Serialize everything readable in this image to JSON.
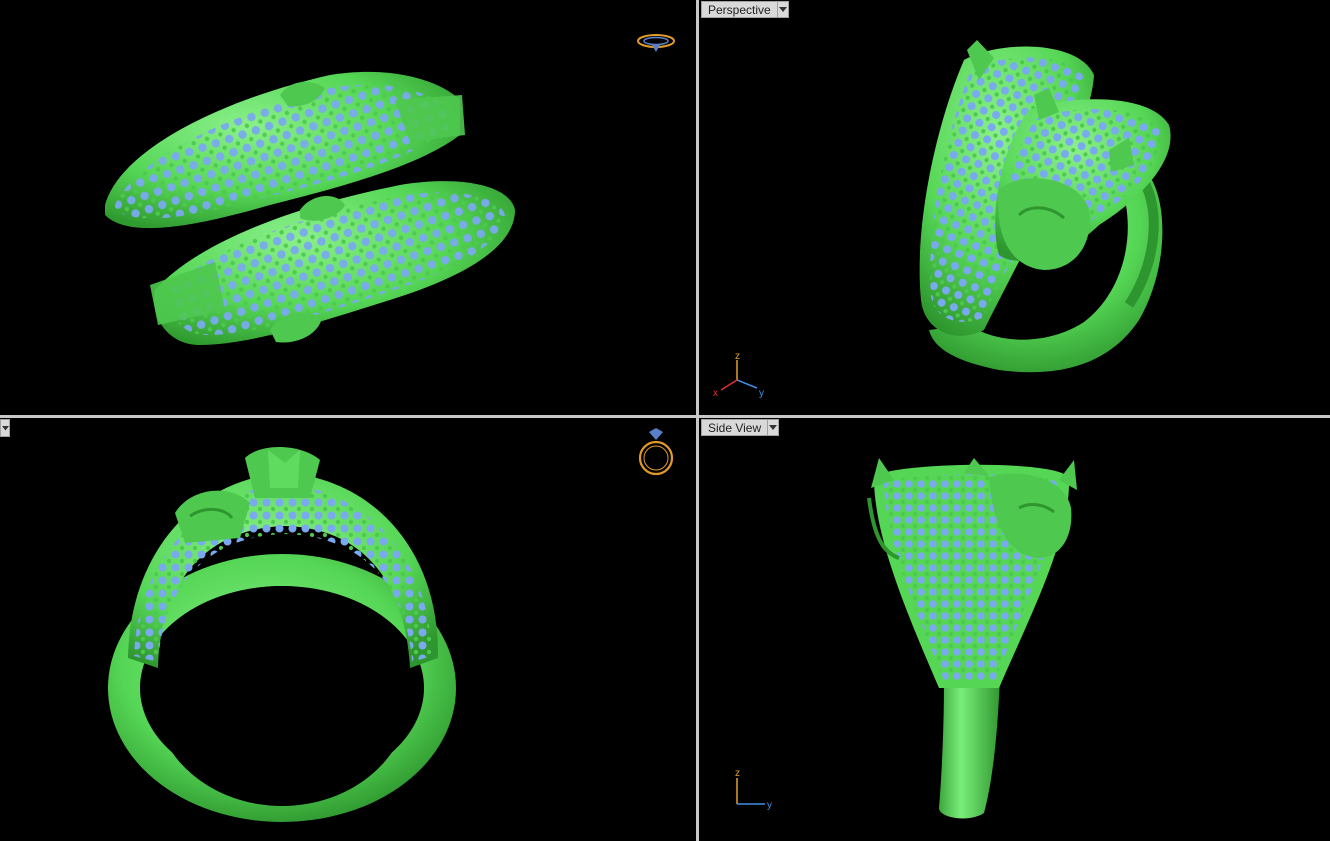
{
  "viewports": {
    "top_left": {
      "label": "",
      "icon": "ring-top-icon"
    },
    "top_right": {
      "label": "Perspective",
      "axes": {
        "x": "x",
        "y": "y",
        "z": "z"
      }
    },
    "bottom_left": {
      "label": "",
      "icon": "ring-front-icon"
    },
    "bottom_right": {
      "label": "Side View",
      "axes": {
        "y": "y",
        "z": "z"
      }
    }
  },
  "colors": {
    "background": "#000000",
    "model_green": "#5fdc5f",
    "gem_blue": "#7aa9ef",
    "divider": "#c8c8c8",
    "axis_x": "#e03030",
    "axis_y": "#3d8fe0",
    "axis_z": "#e0a030",
    "view_icon": "#e09a2a"
  }
}
